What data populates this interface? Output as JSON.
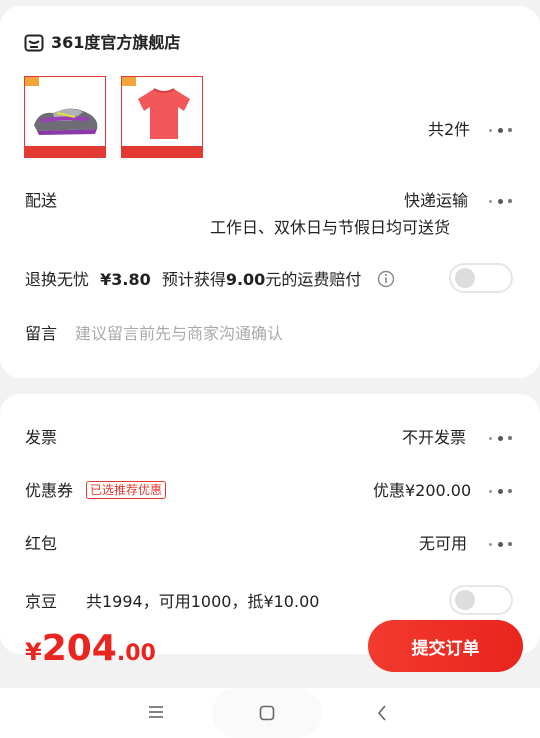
{
  "store": {
    "icon": "store-icon",
    "name": "361度官方旗舰店"
  },
  "products": {
    "count_label": "共2件",
    "items": [
      {
        "icon": "shoe-product-image"
      },
      {
        "icon": "tshirt-product-image"
      }
    ]
  },
  "delivery": {
    "label": "配送",
    "method": "快递运输",
    "note": "工作日、双休日与节假日均可送货"
  },
  "return_insurance": {
    "label": "退换无忧",
    "price": "¥3.80",
    "desc_prefix": "预计获得",
    "desc_amount": "9.00",
    "desc_suffix": "元的运费赔付",
    "enabled": false
  },
  "message": {
    "label": "留言",
    "placeholder": "建议留言前先与商家沟通确认"
  },
  "invoice": {
    "label": "发票",
    "value": "不开发票"
  },
  "coupon": {
    "label": "优惠券",
    "badge": "已选推荐优惠",
    "value": "优惠¥200.00"
  },
  "red_packet": {
    "label": "红包",
    "value": "无可用"
  },
  "jingdou": {
    "label": "京豆",
    "detail": "共1994，可用1000，抵¥10.00",
    "enabled": false
  },
  "total": {
    "currency": "¥",
    "integer": "204",
    "decimal": ".00"
  },
  "submit_label": "提交订单",
  "colors": {
    "accent": "#e8251e",
    "text": "#222222",
    "placeholder": "#aaaaaa"
  }
}
